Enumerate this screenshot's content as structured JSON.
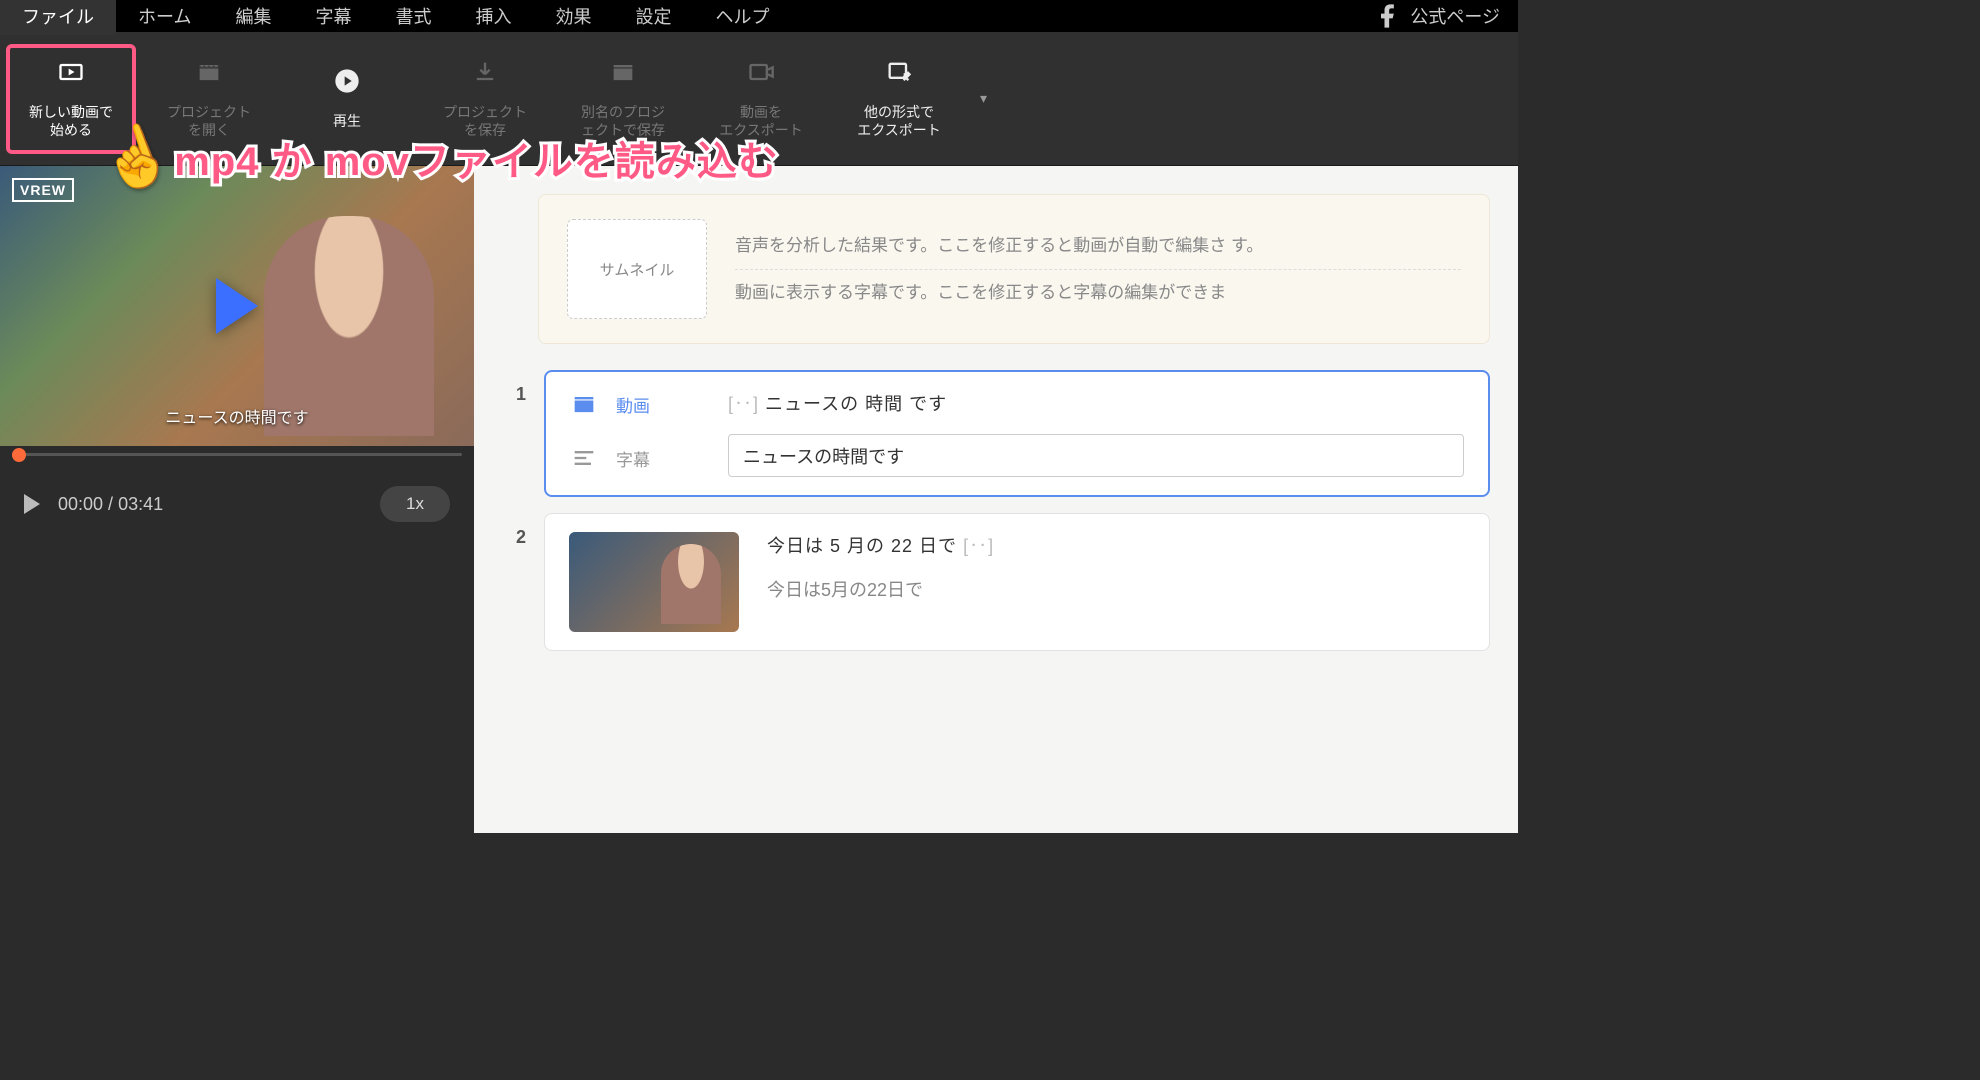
{
  "menubar": {
    "items": [
      "ファイル",
      "ホーム",
      "編集",
      "字幕",
      "書式",
      "挿入",
      "効果",
      "設定",
      "ヘルプ"
    ],
    "active_index": 0,
    "official_page": "公式ページ"
  },
  "toolbar": {
    "new_video": "新しい動画で\n始める",
    "open_project": "プロジェクト\nを開く",
    "play": "再生",
    "save_project": "プロジェクト\nを保存",
    "save_as": "別名のプロジ\nェクトで保存",
    "export_video": "動画を\nエクスポート",
    "export_other": "他の形式で\nエクスポート"
  },
  "preview": {
    "logo": "VREW",
    "burned_caption": "ニュースの時間です"
  },
  "player": {
    "current": "00:00",
    "total": "03:41",
    "speed": "1x"
  },
  "info": {
    "thumbnail_label": "サムネイル",
    "line1": "音声を分析した結果です。ここを修正すると動画が自動で編集さ\nす。",
    "line2": "動画に表示する字幕です。ここを修正すると字幕の編集ができま"
  },
  "clips": [
    {
      "num": "1",
      "video_label": "動画",
      "subtitle_label": "字幕",
      "transcript_prefix": "[‥]",
      "transcript": "ニュースの 時間 です",
      "subtitle": "ニュースの時間です",
      "selected": true,
      "show_icons": true
    },
    {
      "num": "2",
      "transcript": "今日は 5 月の 22 日で",
      "transcript_suffix": "[‥]",
      "subtitle": "今日は5月の22日で",
      "selected": false,
      "show_icons": false
    }
  ],
  "annotation": "mp4 か movファイルを読み込む"
}
